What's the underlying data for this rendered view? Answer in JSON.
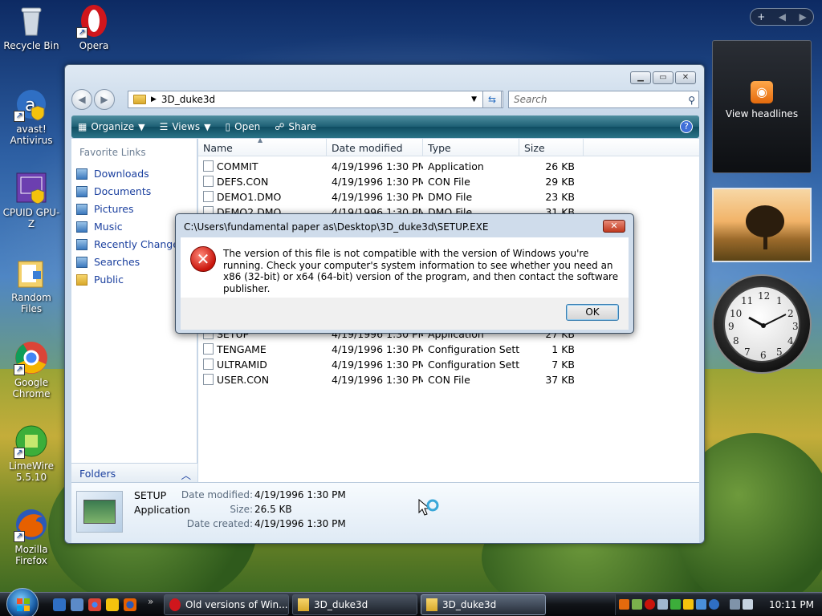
{
  "desktop": {
    "icons": [
      {
        "label": "Recycle Bin"
      },
      {
        "label": "Opera"
      },
      {
        "label_line1": "avast!",
        "label_line2": "Antivirus"
      },
      {
        "label": "CPUID GPU-Z"
      },
      {
        "label": "Random Files"
      },
      {
        "label_line1": "Google",
        "label_line2": "Chrome"
      },
      {
        "label_line1": "LimeWire",
        "label_line2": "5.5.10"
      },
      {
        "label_line1": "Mozilla",
        "label_line2": "Firefox"
      }
    ]
  },
  "explorer": {
    "address_path": "3D_duke3d",
    "search_placeholder": "Search",
    "toolbar": {
      "organize": "Organize",
      "views": "Views",
      "open": "Open",
      "share": "Share"
    },
    "nav": {
      "favorite_links_header": "Favorite Links",
      "links": [
        "Downloads",
        "Documents",
        "Pictures",
        "Music",
        "Recently Changed",
        "Searches",
        "Public"
      ],
      "folders_label": "Folders"
    },
    "columns": {
      "name": "Name",
      "date": "Date modified",
      "type": "Type",
      "size": "Size"
    },
    "files": [
      {
        "name": "COMMIT",
        "date": "4/19/1996 1:30 PM",
        "type": "Application",
        "size": "26 KB"
      },
      {
        "name": "DEFS.CON",
        "date": "4/19/1996 1:30 PM",
        "type": "CON File",
        "size": "29 KB"
      },
      {
        "name": "DEMO1.DMO",
        "date": "4/19/1996 1:30 PM",
        "type": "DMO File",
        "size": "23 KB"
      },
      {
        "name": "DEMO2.DMO",
        "date": "4/19/1996 1:30 PM",
        "type": "DMO File",
        "size": "31 KB"
      }
    ],
    "files_below": [
      {
        "name": "SETUP",
        "date": "4/19/1996 1:30 PM",
        "type": "Application",
        "size": "27 KB"
      },
      {
        "name": "TENGAME",
        "date": "4/19/1996 1:30 PM",
        "type": "Configuration Sett...",
        "size": "1 KB"
      },
      {
        "name": "ULTRAMID",
        "date": "4/19/1996 1:30 PM",
        "type": "Configuration Sett...",
        "size": "7 KB"
      },
      {
        "name": "USER.CON",
        "date": "4/19/1996 1:30 PM",
        "type": "CON File",
        "size": "37 KB"
      }
    ],
    "details": {
      "name": "SETUP",
      "kind": "Application",
      "date_modified_label": "Date modified:",
      "date_modified": "4/19/1996 1:30 PM",
      "size_label": "Size:",
      "size": "26.5 KB",
      "date_created_label": "Date created:",
      "date_created": "4/19/1996 1:30 PM"
    }
  },
  "dialog": {
    "title": "C:\\Users\\fundamental paper as\\Desktop\\3D_duke3d\\SETUP.EXE",
    "message": "The version of this file is not compatible with the version of Windows you're running. Check your computer's system information to see whether you need an x86 (32-bit) or x64 (64-bit) version of the program, and then contact the software publisher.",
    "ok": "OK"
  },
  "sidebar": {
    "rss_label": "View headlines"
  },
  "taskbar": {
    "tasks": [
      "Old versions of Win...",
      "3D_duke3d",
      "3D_duke3d"
    ],
    "time": "10:11 PM"
  },
  "colors": {
    "toolbar": "#1d5f74",
    "link": "#1a3f9e",
    "error": "#c8140b"
  }
}
